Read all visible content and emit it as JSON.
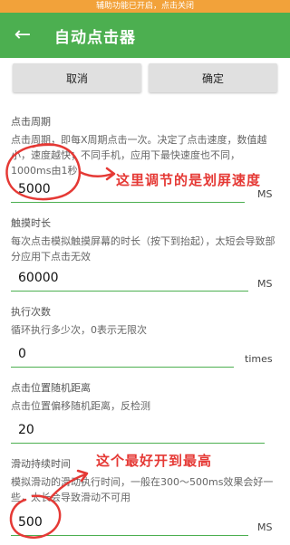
{
  "notice": "辅助功能已开启，点击关闭",
  "appbar": {
    "back_icon": "←",
    "title": "自动点击器"
  },
  "buttons": {
    "cancel": "取消",
    "confirm": "确定"
  },
  "sections": [
    {
      "title": "点击周期",
      "desc": "点击周期，即每X周期点击一次。决定了点击速度，数值越小，速度越快；不同手机，应用下最快速度也不同，1000ms由1秒",
      "value": "5000",
      "unit": "MS"
    },
    {
      "title": "触摸时长",
      "desc": "每次点击模拟触摸屏幕的时长（按下到抬起），太短会导致部分应用下点击无效",
      "value": "60000",
      "unit": "MS"
    },
    {
      "title": "执行次数",
      "desc": "循环执行多少次，0表示无限次",
      "value": "0",
      "unit": "times"
    },
    {
      "title": "点击位置随机距离",
      "desc": "点击位置偏移随机距离，反检测",
      "value": "20",
      "unit": ""
    },
    {
      "title": "滑动持续时间",
      "desc": "模拟滑动的滑动执行时间，一般在300～500ms效果会好一些，太长会导致滑动不可用",
      "value": "500",
      "unit": "MS"
    }
  ],
  "annotations": {
    "note1": "这里调节的是划屏速度",
    "note2": "这个最好开到最高"
  },
  "colors": {
    "primary": "#4caf50",
    "notice": "#f2a23a",
    "annotation": "#e53935"
  }
}
